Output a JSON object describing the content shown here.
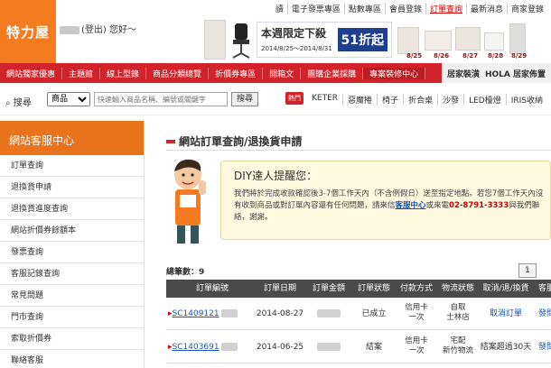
{
  "header": {
    "logo": "特力屋",
    "greeting_prefix": "(登出) 您好～",
    "topnav": [
      "讀",
      "電子發票專區",
      "點數專區",
      "會員登錄",
      "訂單查詢",
      "最新消息",
      "商家登錄"
    ],
    "topnav_active": 4,
    "banner": {
      "title": "本週限定下殺",
      "dates": "2014/8/25～2014/8/31",
      "discount": "51折起"
    },
    "price_tags": [
      "8/25",
      "8/26",
      "8/27",
      "8/28",
      "8/29"
    ]
  },
  "rednav": {
    "items": [
      "網站獨家優惠",
      "主題館",
      "線上型錄",
      "商品分類總覽",
      "折價券專區",
      "開箱文",
      "團購企業採購",
      "專案裝修中心"
    ],
    "right": [
      "居家裝潢",
      "HOLA 居家佈置"
    ]
  },
  "search": {
    "label": "搜尋",
    "category": "商品",
    "placeholder": "快速輸入商品名稱、編號或關鍵字",
    "button": "搜尋",
    "hot_label": "熱門",
    "tags": [
      "KETER",
      "惡魔捲",
      "椅子",
      "折合桌",
      "沙發",
      "LED檯燈",
      "IRIS收納"
    ]
  },
  "sidebar": {
    "title": "網站客服中心",
    "items": [
      "訂單查詢",
      "退換貨申請",
      "退換貨進度查詢",
      "網站折價券餘額本",
      "發票查詢",
      "客服記錄查詢",
      "常見問題",
      "門市查詢",
      "索取折價券",
      "聯絡客服"
    ]
  },
  "main": {
    "title": "網站訂單查詢/退換貨申請",
    "tip_title": "DIY達人提醒您：",
    "tip_body_1": "我們將於完成收款確認後3-7個工作天內（不含例假日）送至指定地點。若您7個工作天內沒有收到商品或對訂單內容還有任何問題，請來信",
    "tip_link": "客服中心",
    "tip_body_2": "或來電",
    "tip_phone": "02-8791-3333",
    "tip_body_3": "與我們聯絡，謝謝。",
    "count_label": "總筆數：9",
    "page": "1",
    "columns": [
      "訂單編號",
      "訂單日期",
      "訂單金額",
      "訂單狀態",
      "付款方式",
      "物流狀態",
      "取消/退/換貨",
      "客服"
    ],
    "rows": [
      {
        "order": "SC1409121",
        "date": "2014-08-27",
        "status": "已成立",
        "pay1": "信用卡",
        "pay2": "一次",
        "ship1": "自取",
        "ship2": "士林店",
        "action": "取消訂單",
        "service": "發問"
      },
      {
        "order": "SC1403691",
        "date": "2014-06-25",
        "status": "結案",
        "pay1": "信用卡",
        "pay2": "一次",
        "ship1": "宅配",
        "ship2": "新竹物流",
        "action": "結案超過30天",
        "service": "發問"
      }
    ]
  }
}
